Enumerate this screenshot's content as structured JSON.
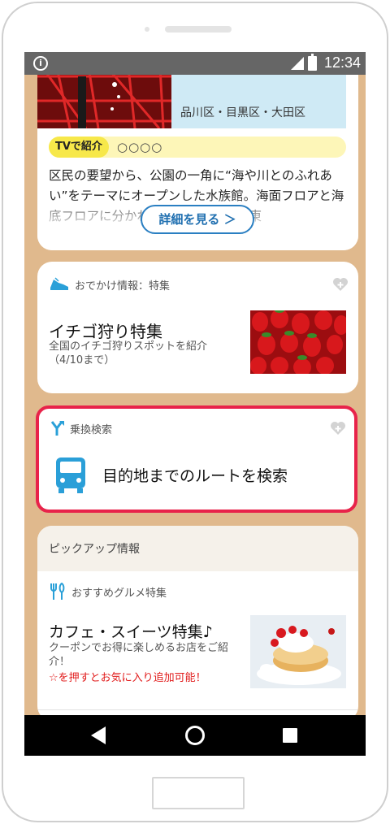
{
  "status_bar": {
    "time": "12:34"
  },
  "card_aquarium": {
    "area": "品川区・目黒区・大田区",
    "tag": "TVで紹介",
    "tag_value": "○○○○",
    "description": "区民の要望から、公園の一角に“海や川とのふれあい”をテーマにオープンした水族館。海面フロアと海底フロアに分かれており、東京湾や東",
    "details_button": "詳細を見る ＞"
  },
  "card_outing": {
    "section_label": "おでかけ情報：特集",
    "title": "イチゴ狩り特集",
    "subtitle": "全国のイチゴ狩りスポットを紹介\n（4/10まで）"
  },
  "card_transit": {
    "section_label": "乗換検索",
    "title": "目的地までのルートを検索"
  },
  "card_pickup": {
    "header": "ピックアップ情報",
    "section_label": "おすすめグルメ特集",
    "title": "カフェ・スイーツ特集♪",
    "subtitle": "クーポンでお得に楽しめるお店をご紹介！",
    "note": "☆を押すとお気に入り追加可能！"
  },
  "colors": {
    "background": "#e0b98d",
    "accent_blue": "#2a7fc2",
    "highlight_red": "#e8234a",
    "tag_yellow": "#f7e84a",
    "note_red": "#e11b1b"
  },
  "icons": [
    "info-icon",
    "signal-icon",
    "battery-icon",
    "sneaker-icon",
    "favorite-add-icon",
    "transfer-icon",
    "bus-icon",
    "cutlery-icon",
    "back-icon",
    "home-icon",
    "recent-apps-icon"
  ]
}
